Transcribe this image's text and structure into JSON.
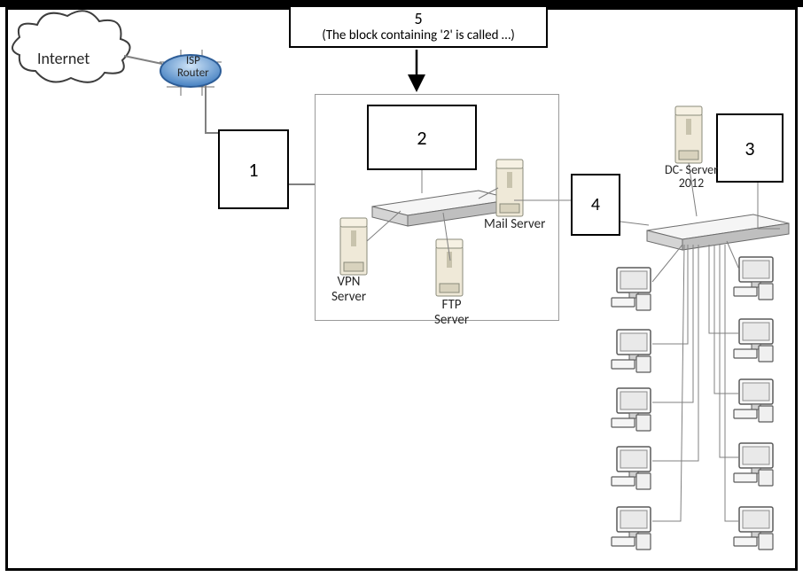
{
  "q5": {
    "line1": "5",
    "line2": "(The block containing '2' is called …)"
  },
  "internet": "Internet",
  "isp": {
    "l1": "ISP",
    "l2": "Router"
  },
  "q1": "1",
  "q2": "2",
  "q3": "3",
  "q4": "4",
  "vpn": {
    "l1": "VPN",
    "l2": "Server"
  },
  "ftp": {
    "l1": "FTP",
    "l2": "Server"
  },
  "mail": "Mail Server",
  "dc": {
    "l1": "DC- Server",
    "l2": "2012"
  }
}
